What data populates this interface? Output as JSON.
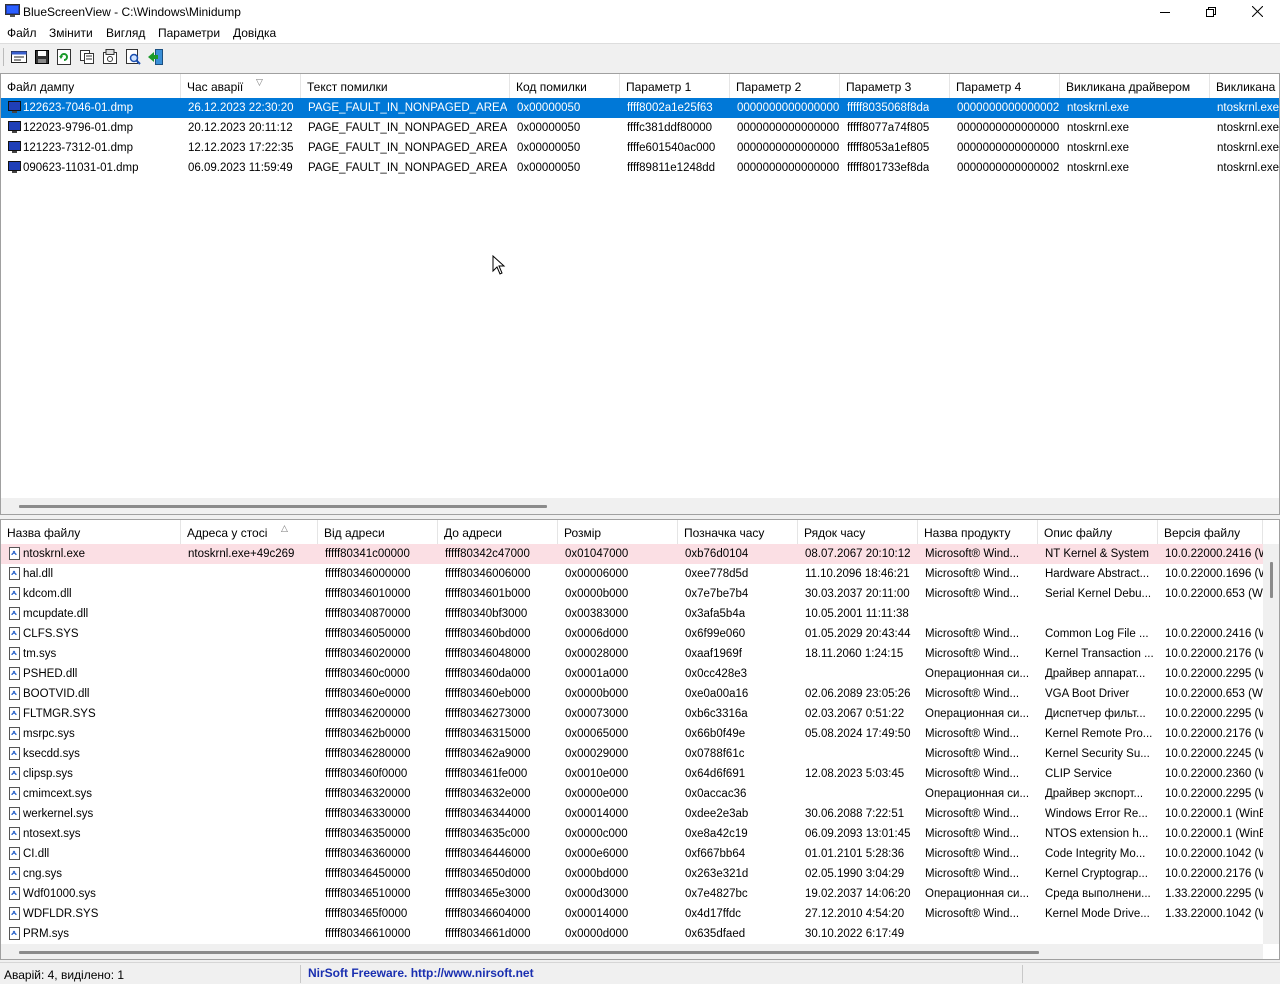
{
  "window": {
    "title": "BlueScreenView  -  C:\\Windows\\Minidump"
  },
  "menu": [
    "Файл",
    "Змінити",
    "Вигляд",
    "Параметри",
    "Довідка"
  ],
  "toolbar_icons": [
    "properties-icon",
    "save-icon",
    "refresh-icon",
    "copy-icon",
    "html-report-icon",
    "find-icon",
    "exit-icon"
  ],
  "top_table": {
    "columns": [
      "Файл дампу",
      "Час аварії",
      "Текст помилки",
      "Код помилки",
      "Параметр 1",
      "Параметр 2",
      "Параметр 3",
      "Параметр 4",
      "Викликана драйвером",
      "Викликана а"
    ],
    "rows": [
      [
        "122623-7046-01.dmp",
        "26.12.2023 22:30:20",
        "PAGE_FAULT_IN_NONPAGED_AREA",
        "0x00000050",
        "ffff8002a1e25f63",
        "0000000000000000",
        "fffff8035068f8da",
        "0000000000000002",
        "ntoskrnl.exe",
        "ntoskrnl.exe"
      ],
      [
        "122023-9796-01.dmp",
        "20.12.2023 20:11:12",
        "PAGE_FAULT_IN_NONPAGED_AREA",
        "0x00000050",
        "ffffc381ddf80000",
        "0000000000000000",
        "fffff8077a74f805",
        "0000000000000000",
        "ntoskrnl.exe",
        "ntoskrnl.exe"
      ],
      [
        "121223-7312-01.dmp",
        "12.12.2023 17:22:35",
        "PAGE_FAULT_IN_NONPAGED_AREA",
        "0x00000050",
        "ffffe601540ac000",
        "0000000000000000",
        "fffff8053a1ef805",
        "0000000000000000",
        "ntoskrnl.exe",
        "ntoskrnl.exe"
      ],
      [
        "090623-11031-01.dmp",
        "06.09.2023 11:59:49",
        "PAGE_FAULT_IN_NONPAGED_AREA",
        "0x00000050",
        "ffff89811e1248dd",
        "0000000000000000",
        "fffff801733ef8da",
        "0000000000000002",
        "ntoskrnl.exe",
        "ntoskrnl.exe"
      ]
    ]
  },
  "bottom_table": {
    "columns": [
      "Назва файлу",
      "Адреса у стосі",
      "Від адреси",
      "До адреси",
      "Розмір",
      "Позначка часу",
      "Рядок часу",
      "Назва продукту",
      "Опис файлу",
      "Версія файлу"
    ],
    "rows": [
      [
        "ntoskrnl.exe",
        "ntoskrnl.exe+49c269",
        "fffff80341c00000",
        "fffff80342c47000",
        "0x01047000",
        "0xb76d0104",
        "08.07.2067 20:10:12",
        "Microsoft® Wind...",
        "NT Kernel & System",
        "10.0.22000.2416 (W"
      ],
      [
        "hal.dll",
        "",
        "fffff80346000000",
        "fffff80346006000",
        "0x00006000",
        "0xee778d5d",
        "11.10.2096 18:46:21",
        "Microsoft® Wind...",
        "Hardware Abstract...",
        "10.0.22000.1696 (W"
      ],
      [
        "kdcom.dll",
        "",
        "fffff80346010000",
        "fffff8034601b000",
        "0x0000b000",
        "0x7e7be7b4",
        "30.03.2037 20:11:00",
        "Microsoft® Wind...",
        "Serial Kernel Debu...",
        "10.0.22000.653 (Wi."
      ],
      [
        "mcupdate.dll",
        "",
        "fffff80340870000",
        "fffff80340bf3000",
        "0x00383000",
        "0x3afa5b4a",
        "10.05.2001 11:11:38",
        "",
        "",
        ""
      ],
      [
        "CLFS.SYS",
        "",
        "fffff80346050000",
        "fffff803460bd000",
        "0x0006d000",
        "0x6f99e060",
        "01.05.2029 20:43:44",
        "Microsoft® Wind...",
        "Common Log File ...",
        "10.0.22000.2416 (W"
      ],
      [
        "tm.sys",
        "",
        "fffff80346020000",
        "fffff80346048000",
        "0x00028000",
        "0xaaf1969f",
        "18.11.2060 1:24:15",
        "Microsoft® Wind...",
        "Kernel Transaction ...",
        "10.0.22000.2176 (W"
      ],
      [
        "PSHED.dll",
        "",
        "fffff803460c0000",
        "fffff803460da000",
        "0x0001a000",
        "0x0cc428e3",
        "",
        "Операционная си...",
        "Драйвер аппарат...",
        "10.0.22000.2295 (W"
      ],
      [
        "BOOTVID.dll",
        "",
        "fffff803460e0000",
        "fffff803460eb000",
        "0x0000b000",
        "0xe0a00a16",
        "02.06.2089 23:05:26",
        "Microsoft® Wind...",
        "VGA Boot Driver",
        "10.0.22000.653 (Wi."
      ],
      [
        "FLTMGR.SYS",
        "",
        "fffff80346200000",
        "fffff80346273000",
        "0x00073000",
        "0xb6c3316a",
        "02.03.2067 0:51:22",
        "Операционная си...",
        "Диспетчер фильт...",
        "10.0.22000.2295 (W"
      ],
      [
        "msrpc.sys",
        "",
        "fffff803462b0000",
        "fffff80346315000",
        "0x00065000",
        "0x66b0f49e",
        "05.08.2024 17:49:50",
        "Microsoft® Wind...",
        "Kernel Remote Pro...",
        "10.0.22000.2176 (W"
      ],
      [
        "ksecdd.sys",
        "",
        "fffff80346280000",
        "fffff803462a9000",
        "0x00029000",
        "0x0788f61c",
        "",
        "Microsoft® Wind...",
        "Kernel Security Su...",
        "10.0.22000.2245 (W"
      ],
      [
        "clipsp.sys",
        "",
        "fffff803460f0000",
        "fffff803461fe000",
        "0x0010e000",
        "0x64d6f691",
        "12.08.2023 5:03:45",
        "Microsoft® Wind...",
        "CLIP Service",
        "10.0.22000.2360 (W"
      ],
      [
        "cmimcext.sys",
        "",
        "fffff80346320000",
        "fffff8034632e000",
        "0x0000e000",
        "0x0accac36",
        "",
        "Операционная си...",
        "Драйвер экспорт...",
        "10.0.22000.2295 (W"
      ],
      [
        "werkernel.sys",
        "",
        "fffff80346330000",
        "fffff80346344000",
        "0x00014000",
        "0xdee2e3ab",
        "30.06.2088 7:22:51",
        "Microsoft® Wind...",
        "Windows Error Re...",
        "10.0.22000.1 (WinB."
      ],
      [
        "ntosext.sys",
        "",
        "fffff80346350000",
        "fffff8034635c000",
        "0x0000c000",
        "0xe8a42c19",
        "06.09.2093 13:01:45",
        "Microsoft® Wind...",
        "NTOS extension h...",
        "10.0.22000.1 (WinB."
      ],
      [
        "CI.dll",
        "",
        "fffff80346360000",
        "fffff80346446000",
        "0x000e6000",
        "0xf667bb64",
        "01.01.2101 5:28:36",
        "Microsoft® Wind...",
        "Code Integrity Mo...",
        "10.0.22000.1042 (W"
      ],
      [
        "cng.sys",
        "",
        "fffff80346450000",
        "fffff8034650d000",
        "0x000bd000",
        "0x263e321d",
        "02.05.1990 3:04:29",
        "Microsoft® Wind...",
        "Kernel Cryptograp...",
        "10.0.22000.2176 (W"
      ],
      [
        "Wdf01000.sys",
        "",
        "fffff80346510000",
        "fffff803465e3000",
        "0x000d3000",
        "0x7e4827bc",
        "19.02.2037 14:06:20",
        "Операционная си...",
        "Среда выполнени...",
        "1.33.22000.2295 (W"
      ],
      [
        "WDFLDR.SYS",
        "",
        "fffff803465f0000",
        "fffff80346604000",
        "0x00014000",
        "0x4d17ffdc",
        "27.12.2010 4:54:20",
        "Microsoft® Wind...",
        "Kernel Mode Drive...",
        "1.33.22000.1042 (W"
      ],
      [
        "PRM.sys",
        "",
        "fffff80346610000",
        "fffff8034661d000",
        "0x0000d000",
        "0x635dfaed",
        "30.10.2022 6:17:49",
        "",
        "",
        ""
      ]
    ]
  },
  "status": {
    "crashes": "Аварій: 4, виділено: 1",
    "freeware": "NirSoft Freeware.  http://www.nirsoft.net"
  },
  "colors": {
    "selection": "#0078d7",
    "highlight_row": "#fbdfe4",
    "freeware_link": "#1a2fb0"
  }
}
